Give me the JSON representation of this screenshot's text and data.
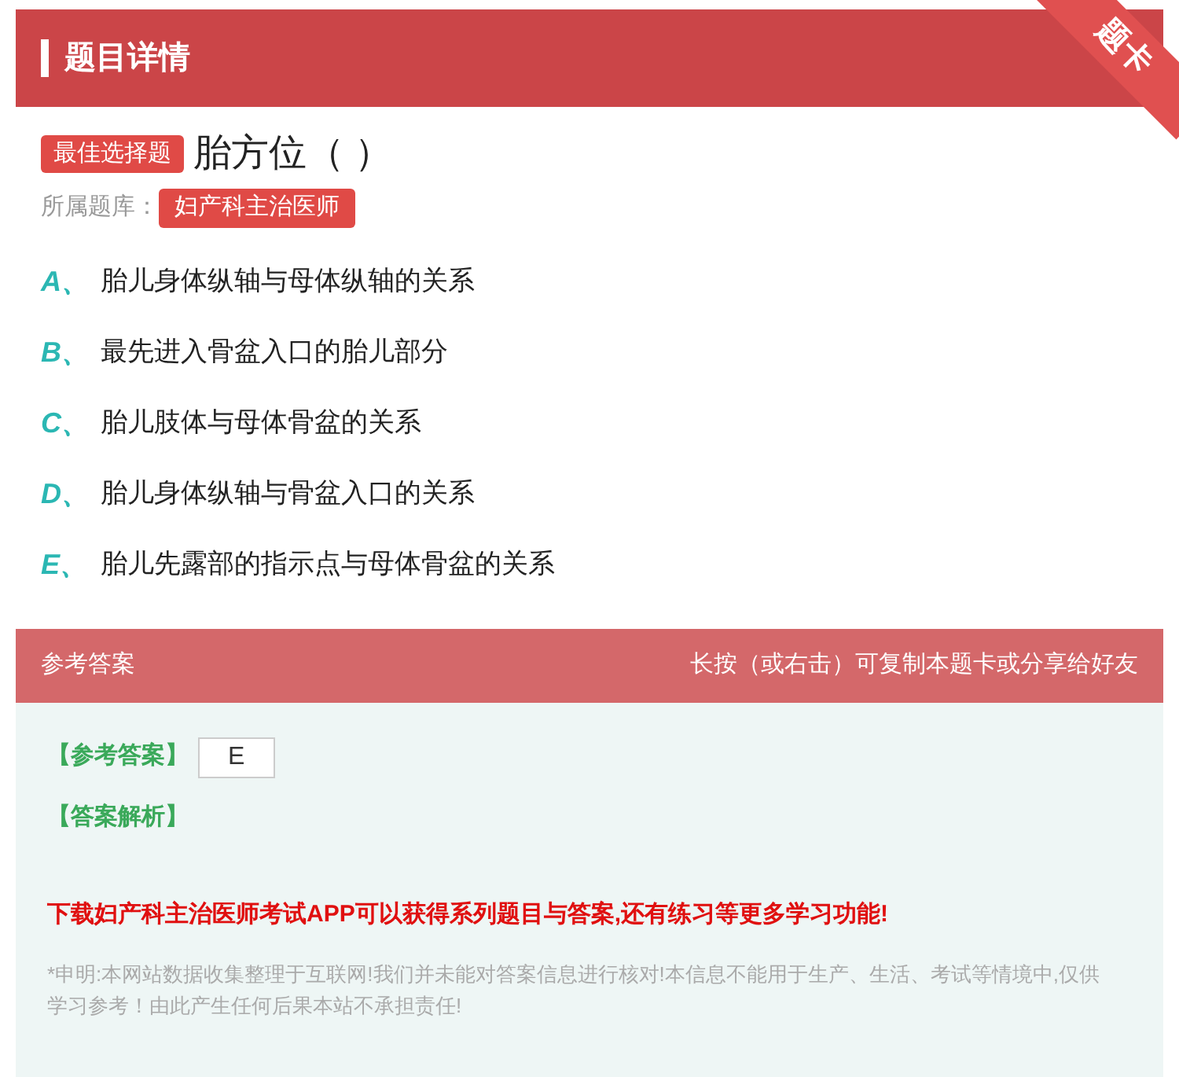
{
  "header": {
    "title": "题目详情",
    "ribbon": "题卡"
  },
  "question": {
    "type_badge": "最佳选择题",
    "stem": "胎方位（ ）",
    "bank_label": "所属题库：",
    "bank": "妇产科主治医师"
  },
  "options": [
    {
      "letter": "A、",
      "text": "胎儿身体纵轴与母体纵轴的关系"
    },
    {
      "letter": "B、",
      "text": "最先进入骨盆入口的胎儿部分"
    },
    {
      "letter": "C、",
      "text": "胎儿肢体与母体骨盆的关系"
    },
    {
      "letter": "D、",
      "text": "胎儿身体纵轴与骨盆入口的关系"
    },
    {
      "letter": "E、",
      "text": "胎儿先露部的指示点与母体骨盆的关系"
    }
  ],
  "answer_bar": {
    "title": "参考答案",
    "hint": "长按（或右击）可复制本题卡或分享给好友"
  },
  "answer": {
    "answer_label": "【参考答案】",
    "answer_value": "E",
    "analysis_label": "【答案解析】",
    "promo": "下载妇产科主治医师考试APP可以获得系列题目与答案,还有练习等更多学习功能!",
    "disclaimer": "*申明:本网站数据收集整理于互联网!我们并未能对答案信息进行核对!本信息不能用于生产、生活、考试等情境中,仅供学习参考！由此产生任何后果本站不承担责任!"
  }
}
